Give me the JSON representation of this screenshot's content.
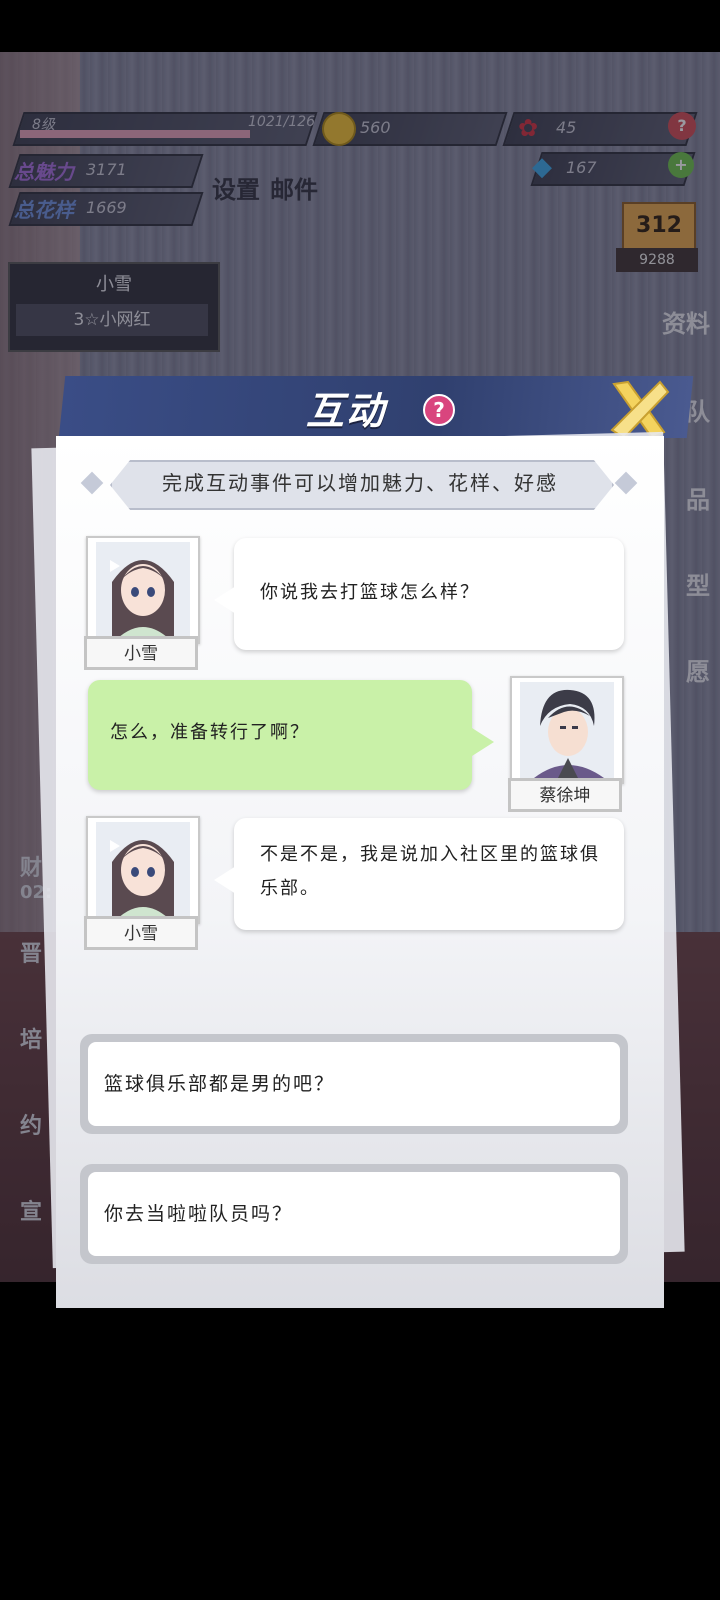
{
  "hud": {
    "level_label": "8级",
    "exp": "1021/126",
    "coins": "560",
    "roses": "45",
    "gems": "167",
    "charm_label": "总魅力",
    "charm_value": "3171",
    "style_label": "总花样",
    "style_value": "1669",
    "settings": "设置",
    "mail": "邮件",
    "rank_value": "9288"
  },
  "character_card": {
    "name": "小雪",
    "title": "3☆小网红"
  },
  "right_tabs": [
    "资料",
    "队",
    "品",
    "型",
    "愿"
  ],
  "left_tabs": [
    "财",
    "晋",
    "培",
    "约",
    "宣"
  ],
  "left_timer": "02:",
  "dialog": {
    "title": "互动",
    "subtitle": "完成互动事件可以增加魅力、花样、好感",
    "messages": [
      {
        "speaker": "小雪",
        "text": "你说我去打篮球怎么样？"
      },
      {
        "speaker": "蔡徐坤",
        "text": "怎么，准备转行了啊？"
      },
      {
        "speaker": "小雪",
        "text": "不是不是，我是说加入社区里的篮球俱乐部。"
      }
    ],
    "choices": [
      "篮球俱乐部都是男的吧？",
      "你去当啦啦队员吗？"
    ]
  },
  "colors": {
    "header": "#3a4d86",
    "green_bubble": "#c9f1a8",
    "close_x": "#f4d35e",
    "help": "#d9457e"
  }
}
